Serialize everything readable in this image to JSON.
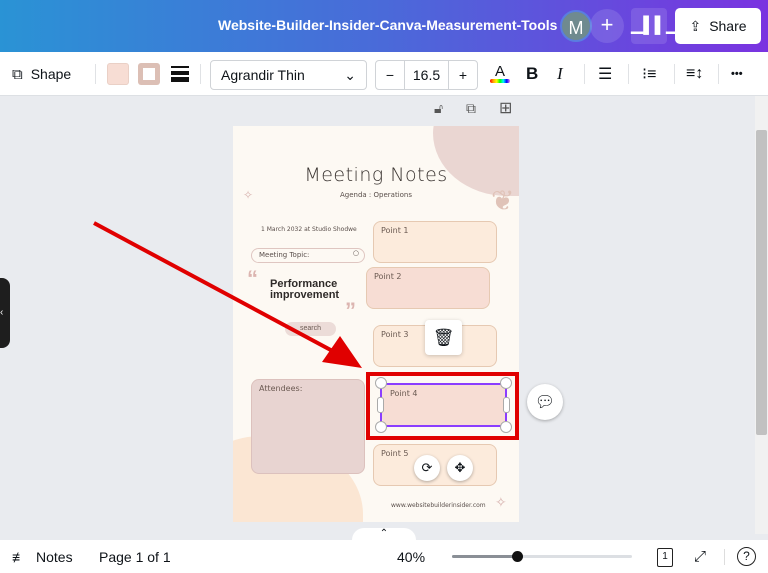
{
  "header": {
    "title": "Website-Builder-Insider-Canva-Measurement-Tools",
    "avatar_initial": "M",
    "plus": "+",
    "share_label": "Share"
  },
  "toolbar": {
    "shape_label": "Shape",
    "font_name": "Agrandir Thin",
    "font_size": "16.5",
    "minus": "−",
    "plus": "+",
    "text_color_glyph": "A",
    "bold": "B",
    "italic": "I",
    "more": "•••"
  },
  "colors": {
    "fill": "#f7ddd4",
    "border": "#dcbfb5",
    "accent": "#8b3dff",
    "annotation": "#e00000"
  },
  "page_actions": {
    "lock": "lock-icon",
    "duplicate": "duplicate-icon",
    "add": "add-page-icon"
  },
  "design": {
    "title": "Meeting Notes",
    "subtitle": "Agenda : Operations",
    "date": "1 March 2032 at Studio Shodwe",
    "topic_label": "Meeting Topic:",
    "topic": "Performance improvement",
    "search": "search",
    "points": [
      "Point 1",
      "Point 2",
      "Point 3",
      "Point 4",
      "Point 5"
    ],
    "attendees": "Attendees:",
    "website": "www.websitebuilderinsider.com"
  },
  "footer": {
    "notes_label": "Notes",
    "page_indicator": "Page 1 of 1",
    "zoom": "40%",
    "zoom_slider_fraction": 0.36,
    "page_count": "1",
    "help": "?"
  }
}
